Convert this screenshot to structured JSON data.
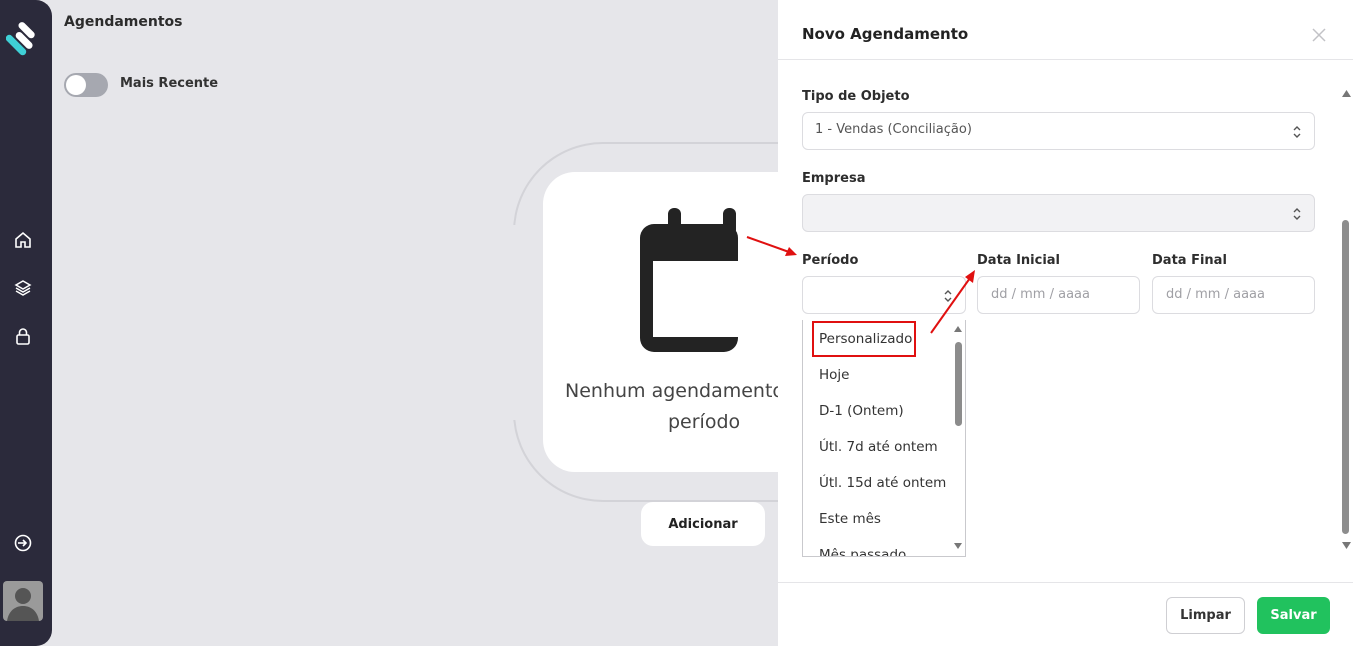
{
  "main": {
    "page_title": "Agendamentos",
    "toggle_label": "Mais Recente",
    "empty_text_line1": "Nenhum agendamento",
    "empty_text_line2": "período",
    "add_button": "Adicionar"
  },
  "sidebar": {
    "items": [
      {
        "icon": "home-icon"
      },
      {
        "icon": "layers-icon"
      },
      {
        "icon": "lock-icon"
      },
      {
        "icon": "logout-icon"
      }
    ]
  },
  "drawer": {
    "title": "Novo Agendamento",
    "fields": {
      "tipo_label": "Tipo de Objeto",
      "tipo_value": "1 - Vendas (Conciliação)",
      "empresa_label": "Empresa",
      "empresa_value": "",
      "periodo_label": "Período",
      "periodo_value": "",
      "data_inicial_label": "Data Inicial",
      "data_inicial_placeholder": "dd / mm / aaaa",
      "data_final_label": "Data Final",
      "data_final_placeholder": "dd / mm / aaaa"
    },
    "periodo_options": [
      "Personalizado",
      "Hoje",
      "D-1 (Ontem)",
      "Útl. 7d até ontem",
      "Útl. 15d até ontem",
      "Este mês",
      "Mês passado"
    ],
    "highlighted_option": "Personalizado",
    "footer": {
      "clear": "Limpar",
      "save": "Salvar"
    }
  },
  "colors": {
    "sidebar": "#2b2a3b",
    "accent_green": "#21c25e",
    "annotation_red": "#e01010",
    "logo_teal": "#3fd0d6"
  }
}
